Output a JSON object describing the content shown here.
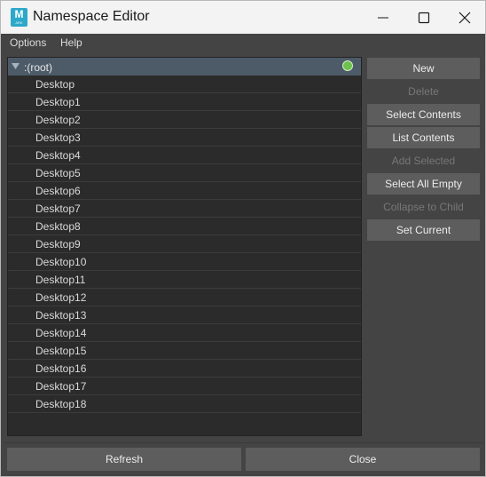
{
  "window": {
    "title": "Namespace Editor",
    "app_icon": {
      "letter": "M",
      "sub": "ARK"
    },
    "controls": [
      "minimize-icon",
      "maximize-icon",
      "close-icon"
    ]
  },
  "menubar": {
    "items": [
      "Options",
      "Help"
    ]
  },
  "tree": {
    "root_label": ":(root)",
    "root_is_current": true,
    "children": [
      "Desktop",
      "Desktop1",
      "Desktop2",
      "Desktop3",
      "Desktop4",
      "Desktop5",
      "Desktop6",
      "Desktop7",
      "Desktop8",
      "Desktop9",
      "Desktop10",
      "Desktop11",
      "Desktop12",
      "Desktop13",
      "Desktop14",
      "Desktop15",
      "Desktop16",
      "Desktop17",
      "Desktop18"
    ]
  },
  "side_buttons": [
    {
      "label": "New",
      "enabled": true
    },
    {
      "label": "Delete",
      "enabled": false
    },
    {
      "label": "Select Contents",
      "enabled": true
    },
    {
      "label": "List Contents",
      "enabled": true
    },
    {
      "label": "Add Selected",
      "enabled": false
    },
    {
      "label": "Select All Empty",
      "enabled": true
    },
    {
      "label": "Collapse to Child",
      "enabled": false
    },
    {
      "label": "Set Current",
      "enabled": true
    }
  ],
  "bottom_buttons": {
    "refresh": "Refresh",
    "close": "Close"
  },
  "colors": {
    "panel": "#444444",
    "list_bg": "#2b2b2b",
    "root_highlight": "#4d5b69",
    "button": "#5d5d5d",
    "current_indicator": "#6cc24a"
  }
}
